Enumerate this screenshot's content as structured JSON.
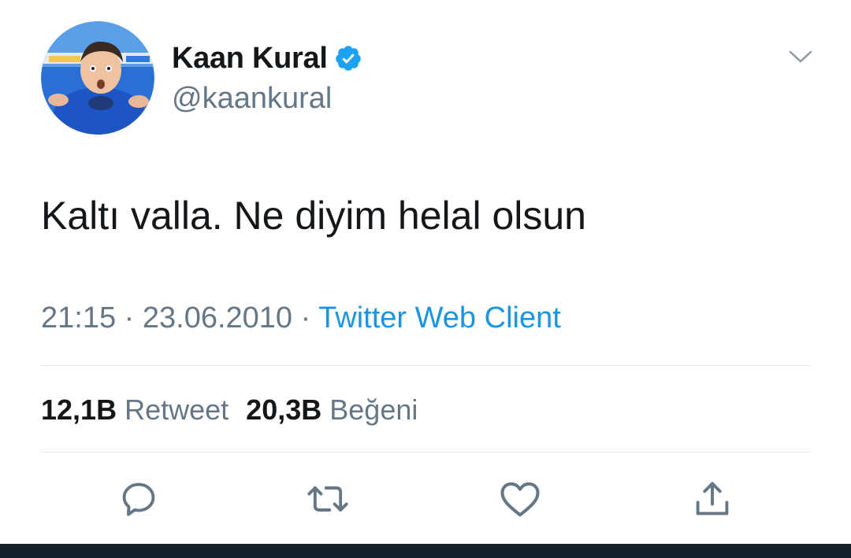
{
  "tweet": {
    "author": {
      "display_name": "Kaan Kural",
      "handle": "@kaankural",
      "verified": true
    },
    "text": "Kaltı valla. Ne diyim helal olsun",
    "time": "21:15",
    "separator": "·",
    "date": "23.06.2010",
    "source": "Twitter Web Client"
  },
  "stats": {
    "retweets_count": "12,1B",
    "retweets_label": "Retweet",
    "likes_count": "20,3B",
    "likes_label": "Beğeni"
  },
  "actions": {
    "reply_icon": "reply-icon",
    "retweet_icon": "retweet-icon",
    "like_icon": "heart-icon",
    "share_icon": "share-icon"
  },
  "colors": {
    "text_primary": "#14171a",
    "text_secondary": "#657786",
    "link": "#1b95e0",
    "verified": "#1da1f2",
    "divider": "#e1e8ed"
  }
}
